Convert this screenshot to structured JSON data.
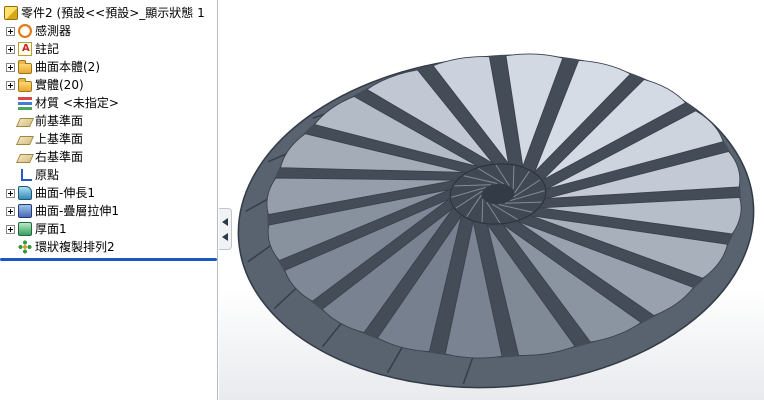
{
  "colors": {
    "rollback_bar": "#1a56c4",
    "tree_background": "#ffffff",
    "rim_dark": "#59636f",
    "blade_light": "#d6dce6",
    "blade_dark": "#76808e"
  },
  "tree": {
    "root": {
      "label": "零件2 (預設<<預設>_顯示狀態 1",
      "icon": "part-icon"
    },
    "items": [
      {
        "label": "感測器",
        "icon": "sensors-icon",
        "expandable": true
      },
      {
        "label": "註記",
        "icon": "annotations-icon",
        "expandable": true
      },
      {
        "label": "曲面本體(2)",
        "icon": "surface-bodies-folder-icon",
        "expandable": true
      },
      {
        "label": "實體(20)",
        "icon": "solid-bodies-folder-icon",
        "expandable": true
      },
      {
        "label": "材質 <未指定>",
        "icon": "material-icon",
        "expandable": false
      },
      {
        "label": "前基準面",
        "icon": "plane-icon",
        "expandable": false
      },
      {
        "label": "上基準面",
        "icon": "plane-icon",
        "expandable": false
      },
      {
        "label": "右基準面",
        "icon": "plane-icon",
        "expandable": false
      },
      {
        "label": "原點",
        "icon": "origin-icon",
        "expandable": false
      },
      {
        "label": "曲面-伸長1",
        "icon": "surface-extrude-icon",
        "expandable": true
      },
      {
        "label": "曲面-疊層拉伸1",
        "icon": "surface-loft-icon",
        "expandable": true
      },
      {
        "label": "厚面1",
        "icon": "thicken-icon",
        "expandable": true
      },
      {
        "label": "環狀複製排列2",
        "icon": "circular-pattern-icon",
        "expandable": false
      }
    ]
  },
  "viewport": {
    "model": "circular-blade-impeller"
  }
}
